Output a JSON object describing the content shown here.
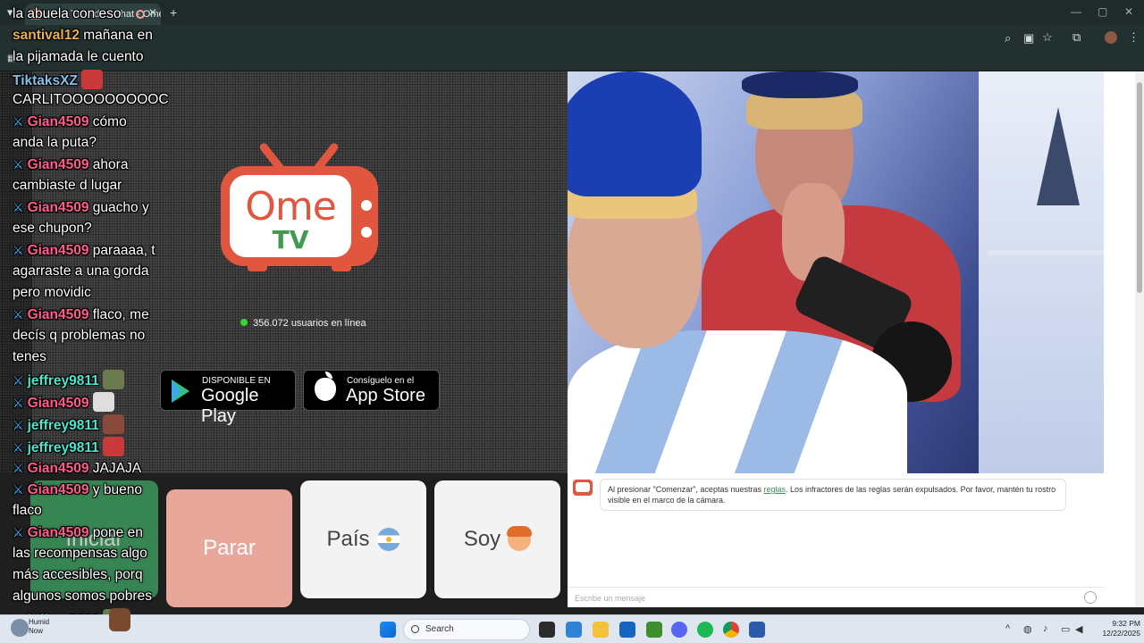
{
  "browser": {
    "tab_title": "Ome TV Video Chat - Omegle",
    "new_tab": "+",
    "tab_close": "✕",
    "minimize": "—",
    "maximize": "▢",
    "close": "✕"
  },
  "app": {
    "brand_ome": "Ome",
    "brand_tv": "TV",
    "online_count": "356.072 usuarios en línea",
    "google_play_small": "DISPONIBLE EN",
    "google_play_big": "Google Play",
    "app_store_small": "Consíguelo en el",
    "app_store_big": "App Store",
    "btn_start": "Iniciar",
    "btn_stop": "Parar",
    "btn_country": "País",
    "btn_gender": "Soy",
    "system_message_before": "Al presionar \"Comenzar\", aceptas nuestras ",
    "system_message_link": "reglas",
    "system_message_after": ". Los infractores de las reglas serán expulsados. Por favor, mantén tu rostro visible en el marco de la cámara.",
    "message_placeholder": "Escribe un mensaje"
  },
  "overlay_chat": [
    {
      "text": "la abuela con eso"
    },
    {
      "user": "santival12",
      "text": " mañana en"
    },
    {
      "text": "la pijamada le cuento"
    },
    {
      "user": "TiktaksXZ"
    },
    {
      "text": "CARLITOOOOOOOOOC"
    },
    {
      "user": "Gian4509",
      "text": " cómo"
    },
    {
      "text": "anda la puta?"
    },
    {
      "user": "Gian4509",
      "text": " ahora"
    },
    {
      "text": "cambiaste d lugar"
    },
    {
      "user": "Gian4509",
      "text": " guacho y"
    },
    {
      "text": "ese chupon?"
    },
    {
      "user": "Gian4509",
      "text": " paraaaa, t"
    },
    {
      "text": "agarraste a una gorda"
    },
    {
      "text": "pero movidic"
    },
    {
      "user": "Gian4509",
      "text": " flaco, me"
    },
    {
      "text": "decís q problemas no"
    },
    {
      "text": "tenes"
    },
    {
      "user": "jeffrey9811"
    },
    {
      "user": "Gian4509"
    },
    {
      "user": "jeffrey9811"
    },
    {
      "user": "jeffrey9811"
    },
    {
      "user": "Gian4509",
      "text": " JAJAJA"
    },
    {
      "user": "Gian4509",
      "text": " y bueno"
    },
    {
      "text": "flaco"
    },
    {
      "user": "Gian4509",
      "text": " pone en"
    },
    {
      "text": "las recompensas algo"
    },
    {
      "text": "más accesibles, porq"
    },
    {
      "text": "algunos somos pobres"
    },
    {
      "user": "jeffrey9811"
    }
  ],
  "taskbar": {
    "search": "Search",
    "weather_line1": "Humid",
    "weather_line2": "Now",
    "time": "9:32 PM",
    "date": "12/22/2025"
  },
  "colors": {
    "brand_red": "#e0563f",
    "brand_green": "#3f9a52",
    "start_green": "#3fa765",
    "stop_salmon": "#e7a89b",
    "online_dot": "#35d631"
  }
}
